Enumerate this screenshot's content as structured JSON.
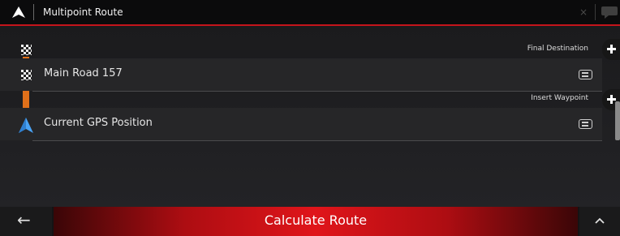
{
  "header": {
    "title": "Multipoint Route",
    "close_glyph": "×",
    "nav_icon": "navigation-arrow-icon",
    "chat_icon": "speech-bubble-icon"
  },
  "actions": {
    "final_destination_label": "Final Destination",
    "insert_waypoint_label": "Insert Waypoint"
  },
  "route": {
    "items": [
      {
        "label": "Main Road 157",
        "icon": "checkered-flag-icon"
      },
      {
        "label": "Current GPS Position",
        "icon": "gps-arrow-icon"
      }
    ]
  },
  "footer": {
    "back_glyph": "←",
    "calculate_label": "Calculate Route",
    "up_icon": "chevron-up-icon"
  },
  "colors": {
    "accent_red": "#c4141b",
    "route_orange": "#e0701a",
    "gps_blue": "#4aa3f5"
  }
}
